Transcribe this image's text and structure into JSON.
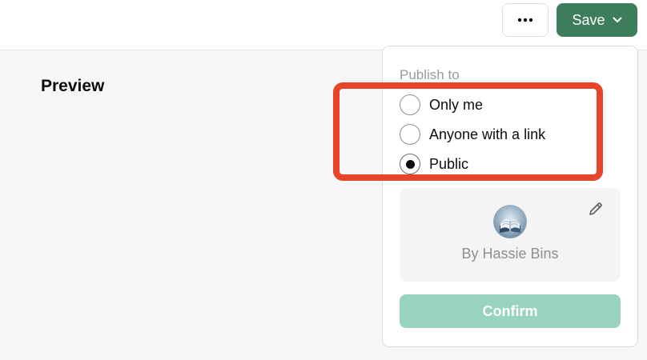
{
  "header": {
    "more_icon": "ellipsis-icon",
    "save_label": "Save",
    "save_color": "#3e7d5c"
  },
  "main": {
    "title": "Preview"
  },
  "publish_panel": {
    "label": "Publish to",
    "options": [
      {
        "label": "Only me",
        "selected": false
      },
      {
        "label": "Anyone with a link",
        "selected": false
      },
      {
        "label": "Public",
        "selected": true
      }
    ],
    "card": {
      "byline": "By Hassie Bins",
      "edit_icon": "pencil-icon",
      "avatar_icon": "book-avatar-icon"
    },
    "confirm_label": "Confirm",
    "confirm_color": "#98d2c1"
  },
  "annotation": {
    "highlight_color": "#e8442a"
  }
}
